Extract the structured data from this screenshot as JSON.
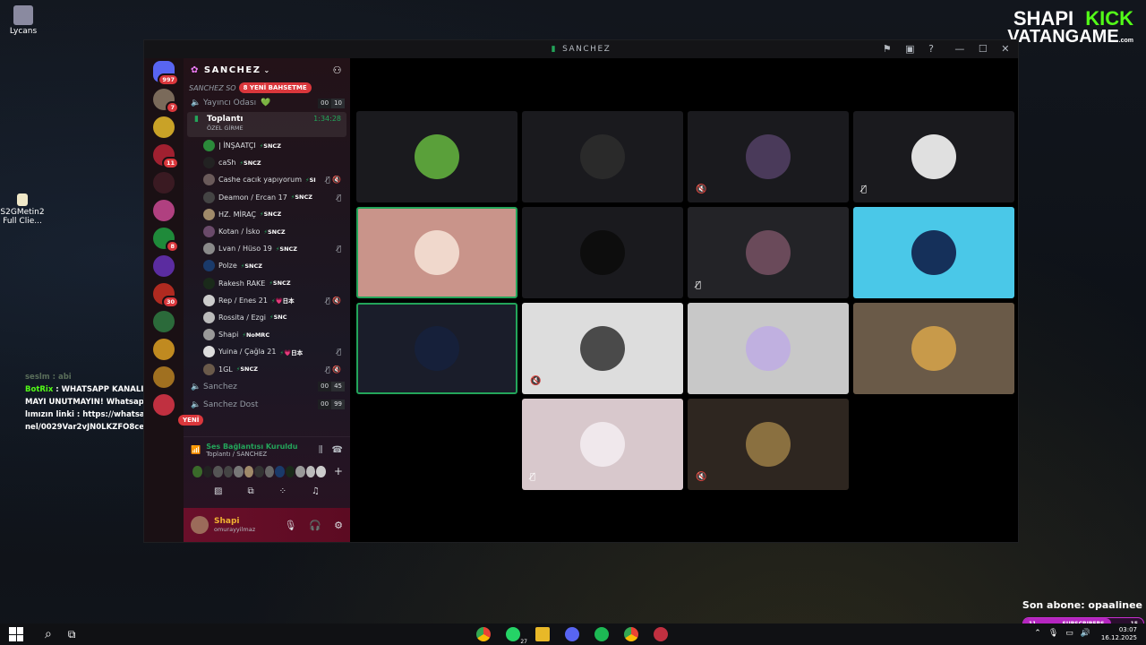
{
  "desktop": {
    "icons": [
      {
        "label": "Lycans"
      },
      {
        "label": "S2GMetin2 Full Clie..."
      }
    ]
  },
  "branding": {
    "shapi": "SHAPI",
    "kick": "KICK",
    "vatan": "VATANGAME",
    "vatan_suffix": ".com"
  },
  "chat_overlay": {
    "line1_user": "seslm",
    "line1_text": ": abi",
    "line2_user": "BotRix",
    "line2_text": ": WHATSAPP KANALIMIZA KATILMAYI UNUTMAYIN! Whatsapp Shapi kanalımızın linki : https://whatsapp.com/channel/0029Var2vJN0LKZFO8ce451g"
  },
  "window": {
    "title": "SANCHEZ",
    "controls": {
      "minimize": "—",
      "maximize": "☐",
      "close": "✕"
    }
  },
  "servers": [
    {
      "name": "discord-home",
      "badge": "997",
      "color": "#5865f2"
    },
    {
      "name": "server-avatar",
      "badge": "7",
      "color": "#7a6a5a"
    },
    {
      "name": "server-ship",
      "badge": "",
      "color": "#c9a227"
    },
    {
      "name": "server-red",
      "badge": "11",
      "color": "#a02030"
    },
    {
      "name": "server-glasses",
      "badge": "",
      "color": "#3a1a22"
    },
    {
      "name": "server-s2",
      "badge": "",
      "color": "#b04080"
    },
    {
      "name": "server-green",
      "badge": "8",
      "color": "#1f8a3a"
    },
    {
      "name": "server-mercy",
      "badge": "",
      "color": "#5b2ca0"
    },
    {
      "name": "server-fire",
      "badge": "30",
      "color": "#b02a20"
    },
    {
      "name": "server-h",
      "badge": "",
      "color": "#2b6a3a"
    },
    {
      "name": "server-lion",
      "badge": "",
      "color": "#c08a20"
    },
    {
      "name": "server-script",
      "badge": "",
      "color": "#a07020"
    },
    {
      "name": "server-new",
      "badge": "",
      "color": "#c03040"
    }
  ],
  "guild": {
    "name": "SANCHEZ",
    "category": "SANCHEZ SO",
    "new_pill": "8 YENİ BAHSETME",
    "channels": [
      {
        "name": "Yayıncı Odası",
        "heart": "💚",
        "c1": "00",
        "c2": "10"
      },
      {
        "name": "Toplantı",
        "sub": "ÖZEL GİRME",
        "timer": "1:34:28"
      }
    ],
    "members": [
      {
        "name": "| İNŞAATÇI",
        "tag": "SNCZ",
        "color": "#2b8a3a",
        "status": ""
      },
      {
        "name": "caSh",
        "tag": "SNCZ",
        "color": "#222",
        "status": ""
      },
      {
        "name": "Cashe cacık yapıyorum",
        "tag": "SI",
        "color": "#6a5a5a",
        "status": "🎙̸ 🔇"
      },
      {
        "name": "Deamon / Ercan 17",
        "tag": "SNCZ",
        "color": "#444",
        "status": "🎙̸"
      },
      {
        "name": "HZ. MİRAÇ",
        "tag": "SNCZ",
        "color": "#a08a6a",
        "status": ""
      },
      {
        "name": "Kotan / İsko",
        "tag": "SNCZ",
        "color": "#6a4a6a",
        "status": ""
      },
      {
        "name": "Lvan / Hüso 19",
        "tag": "SNCZ",
        "color": "#8a8a8a",
        "status": "🎙̸"
      },
      {
        "name": "Polze",
        "tag": "SNCZ",
        "color": "#1a3a6a",
        "status": ""
      },
      {
        "name": "Rakesh RAKE",
        "tag": "SNCZ",
        "color": "#1a2a1a",
        "status": ""
      },
      {
        "name": "Rep / Enes 21",
        "tag": "💗日本",
        "color": "#ccc",
        "status": "🎙̸ 🔇"
      },
      {
        "name": "Rossita / Ezgi",
        "tag": "SNC",
        "color": "#bbb",
        "status": ""
      },
      {
        "name": "Shapi",
        "tag": "NoMRC",
        "color": "#999",
        "status": ""
      },
      {
        "name": "Yuina / Çağla 21",
        "tag": "💗日本",
        "color": "#ddd",
        "status": "🎙̸"
      },
      {
        "name": "1GL",
        "tag": "SNCZ",
        "color": "#6a5a4a",
        "status": "🎙̸ 🔇"
      }
    ],
    "after_channels": [
      {
        "name": "Sanchez",
        "c1": "00",
        "c2": "45"
      },
      {
        "name": "Sanchez Dost",
        "c1": "00",
        "c2": "99"
      }
    ],
    "yeni_pill": "YENİ"
  },
  "voice_panel": {
    "status": "Ses Bağlantısı Kuruldu",
    "channel": "Toplantı / SANCHEZ",
    "avatar_colors": [
      "#3a6a2a",
      "#222",
      "#555",
      "#444",
      "#777",
      "#a08a6a",
      "#333",
      "#666",
      "#1a3a6a",
      "#1a2a1a",
      "#999",
      "#bbb",
      "#ccc"
    ]
  },
  "user_panel": {
    "name": "Shapi",
    "handle": "omurayyilmaz"
  },
  "tiles": [
    {
      "bg": "#1a1a1e",
      "pic": "#5aa03a",
      "mute": "",
      "speaking": false
    },
    {
      "bg": "#1a1a1e",
      "pic": "#2a2a2a",
      "mute": "",
      "speaking": false
    },
    {
      "bg": "#1a1a1e",
      "pic": "#4a3a5a",
      "mute": "🔇",
      "speaking": false
    },
    {
      "bg": "#1a1a1e",
      "pic": "#e0e0e0",
      "mute": "🎙̸",
      "speaking": false
    },
    {
      "bg": "#c9948a",
      "pic": "#f0d8cc",
      "mute": "",
      "speaking": true
    },
    {
      "bg": "#1a1a1e",
      "pic": "#0d0d0d",
      "mute": "",
      "speaking": false
    },
    {
      "bg": "#232327",
      "pic": "#6a4a5a",
      "mute": "🎙̸",
      "speaking": false
    },
    {
      "bg": "#4ac8e8",
      "pic": "#15305a",
      "mute": "",
      "speaking": false
    },
    {
      "bg": "#1a1d2a",
      "pic": "#16203a",
      "mute": "",
      "speaking": true
    },
    {
      "bg": "#dddddd",
      "pic": "#4a4a4a",
      "mute": "🔇",
      "speaking": false
    },
    {
      "bg": "#c8c8c8",
      "pic": "#c0b0e0",
      "mute": "",
      "speaking": false
    },
    {
      "bg": "#6a5a48",
      "pic": "#c89a4a",
      "mute": "",
      "speaking": false
    },
    {
      "bg": "#d8c8cc",
      "pic": "#f0e8ec",
      "mute": "🎙̸",
      "speaking": false
    },
    {
      "bg": "#2e2620",
      "pic": "#8a7040",
      "mute": "🔇",
      "speaking": false
    }
  ],
  "taskbar": {
    "whatsapp_badge": "27",
    "time": "03:07",
    "date": "16.12.2025"
  },
  "overlay": {
    "son_abone": "Son abone: opaalinee",
    "subs_count": "11",
    "subs_label": "SUBSCRIBERS",
    "subs_goal": "15",
    "subs_progress": 0.73
  }
}
